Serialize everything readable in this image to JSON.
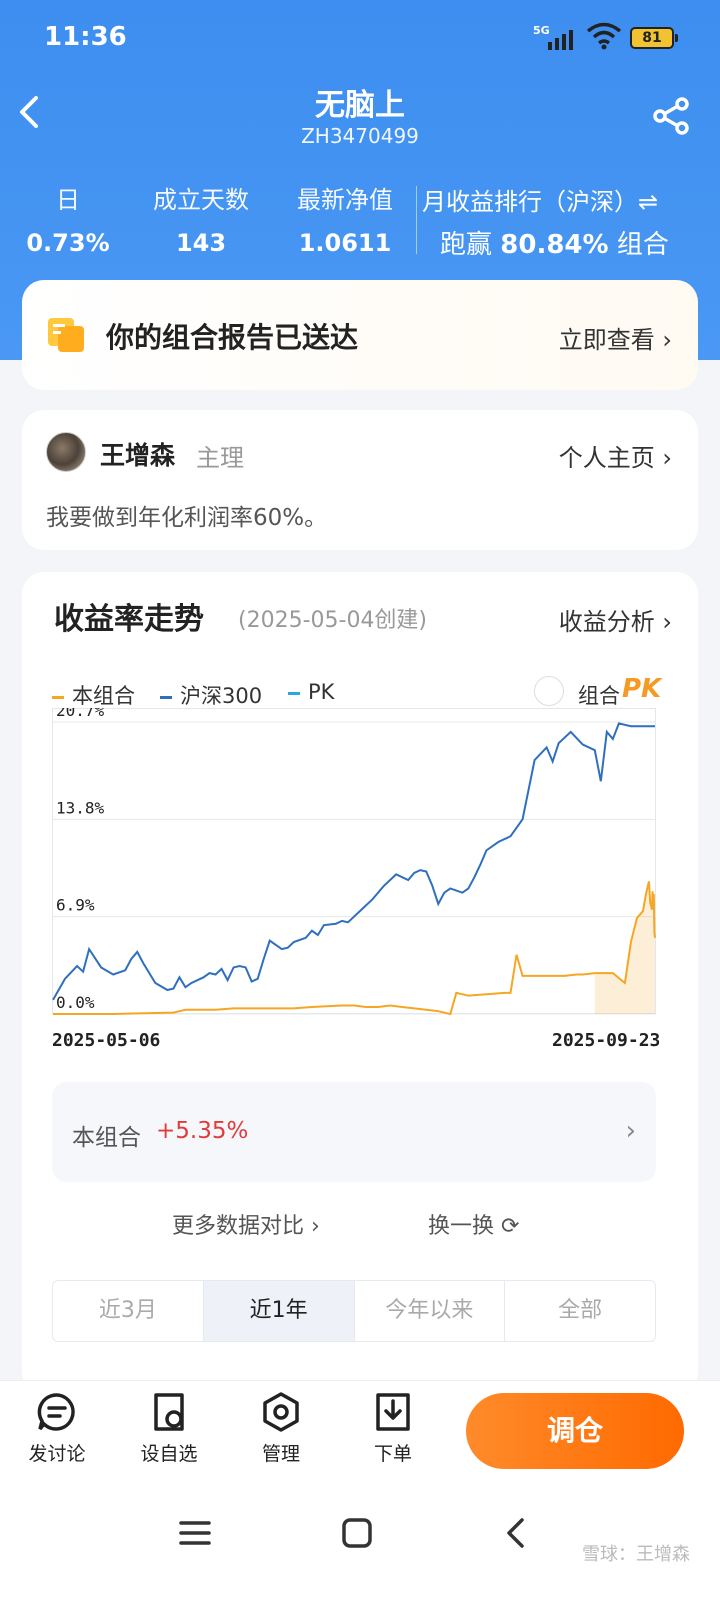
{
  "status": {
    "time": "11:36",
    "network": "5G",
    "battery": "81"
  },
  "header": {
    "title": "无脑上",
    "code": "ZH3470499"
  },
  "stats": [
    {
      "label": "日",
      "value": "0.73%"
    },
    {
      "label": "成立天数",
      "value": "143"
    },
    {
      "label": "最新净值",
      "value": "1.0611"
    }
  ],
  "rank": {
    "label": "月收益排行（沪深）⇌",
    "prefix": "跑赢 ",
    "value": "80.84%",
    "suffix": " 组合"
  },
  "report": {
    "text": "你的组合报告已送达",
    "link": "立即查看 ›"
  },
  "owner": {
    "name": "王增森",
    "role": "主理",
    "link": "个人主页 ›",
    "motto": "我要做到年化利润率60%。"
  },
  "chart_section": {
    "title": "收益率走势",
    "created": "(2025-05-04创建)",
    "link": "收益分析 ›"
  },
  "legend": {
    "items": [
      "本组合",
      "沪深300",
      "PK"
    ],
    "pk_label": "组合",
    "pk_logo": "PK"
  },
  "colors": {
    "portfolio": "#f5a623",
    "csi300": "#2f6fbf",
    "pk": "#29a8e0",
    "accent": "#ff6a00",
    "header": "#3d8ef0",
    "positive": "#e23b3b"
  },
  "chart_data": {
    "type": "line",
    "y_ticks": [
      "20.7%",
      "13.8%",
      "6.9%",
      "0.0%"
    ],
    "ylim": [
      0,
      20.7
    ],
    "x_start": "2025-05-06",
    "x_end": "2025-09-23",
    "series": [
      {
        "name": "沪深300",
        "values": [
          1.0,
          2.5,
          3.4,
          3.0,
          4.6,
          3.3,
          2.8,
          3.1,
          3.9,
          4.4,
          3.6,
          2.2,
          1.7,
          1.8,
          2.6,
          1.9,
          2.2,
          2.6,
          2.9,
          2.8,
          3.2,
          2.4,
          3.3,
          3.4,
          3.3,
          2.3,
          2.5,
          3.9,
          5.2,
          4.6,
          4.7,
          5.1,
          5.4,
          5.9,
          5.6,
          6.3,
          6.4,
          6.6,
          6.5,
          7.3,
          8.1,
          9.1,
          9.9,
          9.5,
          10.0,
          10.2,
          10.1,
          9.1,
          7.8,
          8.6,
          8.9,
          8.6,
          8.9,
          9.7,
          10.6,
          11.6,
          12.2,
          12.6,
          13.8,
          18.0,
          18.9,
          17.9,
          19.2,
          20.0,
          19.1,
          18.7,
          16.5,
          20.0,
          19.5,
          20.6,
          20.4,
          20.4
        ],
        "x_fracs": [
          0,
          0.02,
          0.04,
          0.05,
          0.06,
          0.08,
          0.1,
          0.12,
          0.13,
          0.14,
          0.15,
          0.17,
          0.19,
          0.2,
          0.21,
          0.22,
          0.23,
          0.25,
          0.26,
          0.27,
          0.28,
          0.29,
          0.3,
          0.31,
          0.32,
          0.33,
          0.34,
          0.35,
          0.36,
          0.38,
          0.39,
          0.4,
          0.42,
          0.43,
          0.44,
          0.45,
          0.47,
          0.48,
          0.49,
          0.51,
          0.53,
          0.55,
          0.57,
          0.59,
          0.6,
          0.61,
          0.62,
          0.63,
          0.64,
          0.65,
          0.66,
          0.68,
          0.69,
          0.7,
          0.71,
          0.72,
          0.74,
          0.76,
          0.78,
          0.8,
          0.82,
          0.83,
          0.84,
          0.86,
          0.88,
          0.9,
          0.91,
          0.92,
          0.93,
          0.94,
          0.96,
          1.0
        ]
      },
      {
        "name": "本组合",
        "values": [
          0,
          0,
          0.1,
          0.2,
          0.3,
          0.3,
          0.4,
          0.4,
          0.4,
          0.5,
          0.6,
          0.6,
          0.5,
          0.5,
          0.6,
          0.5,
          0.4,
          0.3,
          0.2,
          0.0,
          1.5,
          1.3,
          1.4,
          1.5,
          1.5,
          4.2,
          2.7,
          2.7,
          2.8,
          2.8,
          2.9,
          2.9,
          2.2,
          5.1,
          6.8,
          7.3,
          8.5,
          9.4,
          7.9,
          7.4,
          8.7,
          7.6,
          8.5,
          5.8,
          5.4
        ],
        "x_fracs": [
          0,
          0.1,
          0.2,
          0.21,
          0.22,
          0.27,
          0.3,
          0.36,
          0.4,
          0.43,
          0.48,
          0.5,
          0.52,
          0.54,
          0.56,
          0.58,
          0.6,
          0.62,
          0.64,
          0.66,
          0.67,
          0.69,
          0.72,
          0.75,
          0.76,
          0.77,
          0.78,
          0.85,
          0.87,
          0.88,
          0.9,
          0.93,
          0.95,
          0.96,
          0.97,
          0.98,
          0.985,
          0.99,
          0.992,
          0.995,
          0.996,
          0.997,
          0.998,
          0.999,
          1.0
        ]
      }
    ]
  },
  "summary": {
    "label": "本组合",
    "value": "+5.35%"
  },
  "actions": {
    "more": "更多数据对比 ›",
    "swap": "换一换 ⟳"
  },
  "ranges": [
    "近3月",
    "近1年",
    "今年以来",
    "全部"
  ],
  "active_range": "近1年",
  "toolbar": {
    "items": [
      "发讨论",
      "设自选",
      "管理",
      "下单"
    ],
    "trade": "调仓"
  },
  "watermark": "雪球：王增森"
}
